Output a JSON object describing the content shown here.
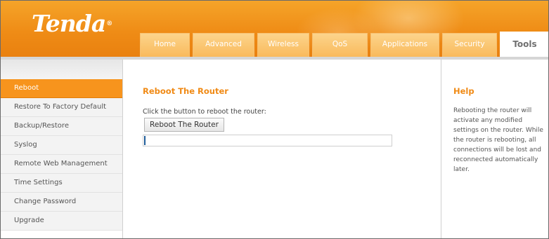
{
  "brand": {
    "logo": "Tenda",
    "reg": "®"
  },
  "tabs": [
    {
      "label": "Home",
      "active": false
    },
    {
      "label": "Advanced",
      "active": false
    },
    {
      "label": "Wireless",
      "active": false
    },
    {
      "label": "QoS",
      "active": false
    },
    {
      "label": "Applications",
      "active": false
    },
    {
      "label": "Security",
      "active": false
    },
    {
      "label": "Tools",
      "active": true
    }
  ],
  "sidebar": {
    "items": [
      {
        "label": "Reboot",
        "active": true
      },
      {
        "label": "Restore To Factory Default",
        "active": false
      },
      {
        "label": "Backup/Restore",
        "active": false
      },
      {
        "label": "Syslog",
        "active": false
      },
      {
        "label": "Remote Web Management",
        "active": false
      },
      {
        "label": "Time Settings",
        "active": false
      },
      {
        "label": "Change Password",
        "active": false
      },
      {
        "label": "Upgrade",
        "active": false
      }
    ]
  },
  "main": {
    "title": "Reboot The Router",
    "instruction": "Click the button to reboot the router:",
    "button_label": "Reboot The Router",
    "progress_fraction": 0.006
  },
  "help": {
    "title": "Help",
    "text": "Rebooting the router will activate any modified settings on the router. While the router is rebooting, all connections will be lost and reconnected automatically later."
  },
  "colors": {
    "brand_orange": "#f7941d",
    "title_orange": "#f08a15",
    "progress_blue": "#1f5d9a"
  }
}
